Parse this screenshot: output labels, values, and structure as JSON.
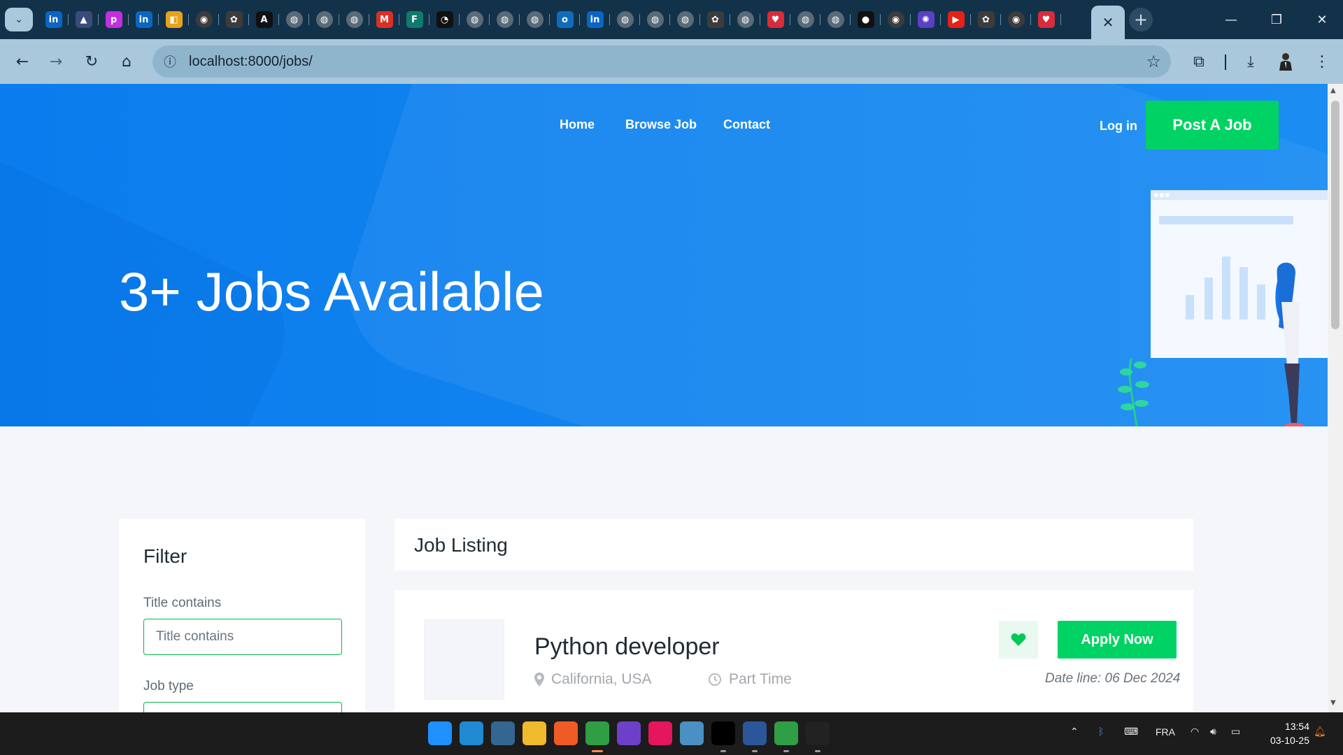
{
  "browser": {
    "url": "localhost:8000/jobs/",
    "active_tab_close": "✕",
    "new_tab": "+",
    "window_controls": {
      "minimize": "—",
      "restore": "❐",
      "close": "✕"
    },
    "pinned_tabs": [
      {
        "icon": "linkedin-icon",
        "glyph": "in",
        "color": "#0a66c2"
      },
      {
        "icon": "arc-icon",
        "glyph": "▲",
        "color": "#3a4a7a"
      },
      {
        "icon": "picsart-icon",
        "glyph": "p",
        "color": "#c12fdf"
      },
      {
        "icon": "linkedin-icon",
        "glyph": "in",
        "color": "#0a66c2"
      },
      {
        "icon": "slides-icon",
        "glyph": "◧",
        "color": "#e8a21a"
      },
      {
        "icon": "chrome-icon",
        "glyph": "◉",
        "color": "#3c3c3c"
      },
      {
        "icon": "chatgpt-icon",
        "glyph": "✿",
        "color": "#3c3c3c"
      },
      {
        "icon": "anthropic-icon",
        "glyph": "A",
        "color": "#111111"
      },
      {
        "icon": "globe-icon",
        "glyph": "◍",
        "color": "#5a6b78"
      },
      {
        "icon": "globe-icon",
        "glyph": "◍",
        "color": "#5a6b78"
      },
      {
        "icon": "globe-icon",
        "glyph": "◍",
        "color": "#5a6b78"
      },
      {
        "icon": "gmail-icon",
        "glyph": "M",
        "color": "#d93025"
      },
      {
        "icon": "forms-icon",
        "glyph": "F",
        "color": "#0f7b6c"
      },
      {
        "icon": "dashboard-icon",
        "glyph": "◔",
        "color": "#111111"
      },
      {
        "icon": "globe-icon",
        "glyph": "◍",
        "color": "#5a6b78"
      },
      {
        "icon": "globe-icon",
        "glyph": "◍",
        "color": "#5a6b78"
      },
      {
        "icon": "globe-icon",
        "glyph": "◍",
        "color": "#5a6b78"
      },
      {
        "icon": "outlook-icon",
        "glyph": "o",
        "color": "#0f6cbd"
      },
      {
        "icon": "linkedin-icon",
        "glyph": "in",
        "color": "#0a66c2"
      },
      {
        "icon": "globe-icon",
        "glyph": "◍",
        "color": "#5a6b78"
      },
      {
        "icon": "globe-icon",
        "glyph": "◍",
        "color": "#5a6b78"
      },
      {
        "icon": "globe-icon",
        "glyph": "◍",
        "color": "#5a6b78"
      },
      {
        "icon": "chatgpt-icon",
        "glyph": "✿",
        "color": "#3c3c3c"
      },
      {
        "icon": "globe-icon",
        "glyph": "◍",
        "color": "#5a6b78"
      },
      {
        "icon": "heart-icon",
        "glyph": "♥",
        "color": "#d92b3a"
      },
      {
        "icon": "globe-icon",
        "glyph": "◍",
        "color": "#5a6b78"
      },
      {
        "icon": "globe-icon",
        "glyph": "◍",
        "color": "#5a6b78"
      },
      {
        "icon": "github-icon",
        "glyph": "●",
        "color": "#111111"
      },
      {
        "icon": "chrome-icon",
        "glyph": "◉",
        "color": "#3c3c3c"
      },
      {
        "icon": "extension-icon",
        "glyph": "✺",
        "color": "#5b3fc4"
      },
      {
        "icon": "youtube-icon",
        "glyph": "▶",
        "color": "#e62117"
      },
      {
        "icon": "chatgpt-icon",
        "glyph": "✿",
        "color": "#3c3c3c"
      },
      {
        "icon": "chrome-icon",
        "glyph": "◉",
        "color": "#3c3c3c"
      },
      {
        "icon": "heart-icon",
        "glyph": "♥",
        "color": "#d92b3a"
      }
    ]
  },
  "site": {
    "nav": {
      "home": "Home",
      "browse": "Browse Job",
      "contact": "Contact"
    },
    "login": "Log in",
    "post_job": "Post A Job",
    "hero_title": "3+ Jobs Available",
    "colors": {
      "hero": "#0a7ced",
      "accent_green": "#00d363"
    }
  },
  "filter": {
    "title": "Filter",
    "title_label": "Title contains",
    "title_placeholder": "Title contains",
    "type_label": "Job type"
  },
  "listing": {
    "header": "Job Listing",
    "jobs": [
      {
        "title": "Python developer",
        "location": "California, USA",
        "type": "Part Time",
        "apply": "Apply Now",
        "deadline": "Date line: 06 Dec 2024"
      }
    ]
  },
  "taskbar": {
    "language": "FRA",
    "time": "13:54",
    "date": "03-10-25",
    "apps": [
      {
        "icon": "windows-start-icon",
        "color": "#1e90ff"
      },
      {
        "icon": "vscode-icon",
        "color": "#1f8ad2"
      },
      {
        "icon": "postgresql-icon",
        "color": "#336791"
      },
      {
        "icon": "file-explorer-icon",
        "color": "#f1b92c"
      },
      {
        "icon": "postman-icon",
        "color": "#ef5b25"
      },
      {
        "icon": "chrome-icon",
        "color": "#2f9e44"
      },
      {
        "icon": "github-desktop-icon",
        "color": "#6e40c9"
      },
      {
        "icon": "intellij-icon",
        "color": "#e4165d"
      },
      {
        "icon": "keyboard-app-icon",
        "color": "#4a90c2"
      },
      {
        "icon": "terminal-icon",
        "color": "#000000"
      },
      {
        "icon": "word-icon",
        "color": "#2b579a"
      },
      {
        "icon": "chrome-icon",
        "color": "#2f9e44"
      },
      {
        "icon": "webstorm-icon",
        "color": "#222222"
      }
    ]
  }
}
